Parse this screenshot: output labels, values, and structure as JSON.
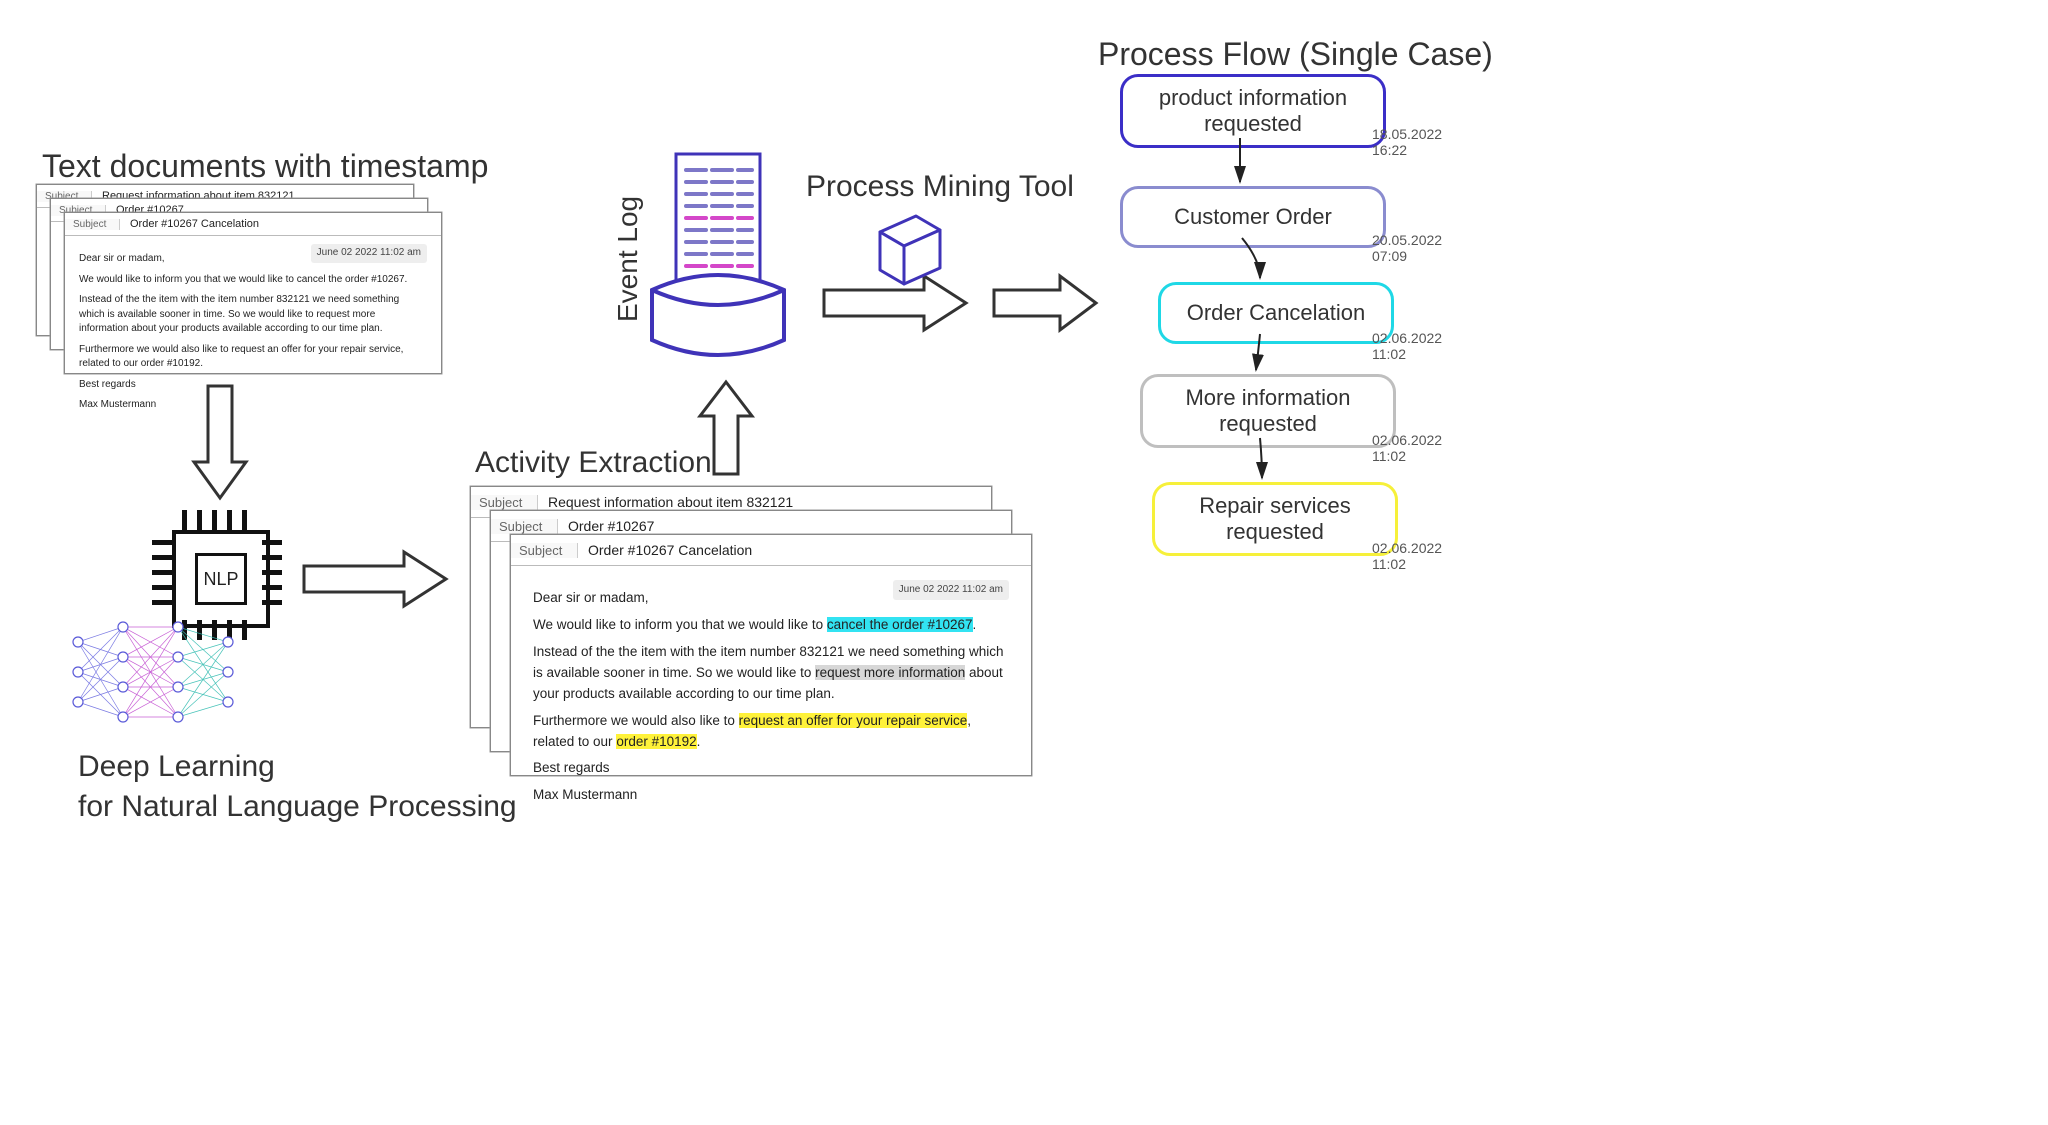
{
  "sectionTitles": {
    "documents": "Text documents with timestamp",
    "deepLearning1": "Deep Learning",
    "deepLearning2": "for Natural Language Processing",
    "activityExtraction": "Activity Extraction",
    "eventLog": "Event Log",
    "processMiningTool": "Process Mining Tool",
    "processFlow": "Process Flow (Single Case)"
  },
  "chipLabel": "NLP",
  "subjectFieldLabel": "Subject",
  "emails": {
    "s1_subject": "Request information about item 832121",
    "s2_subject": "Order #10267",
    "s3_subject": "Order #10267 Cancelation",
    "timestamp": "June 02 2022 11:02 am",
    "greeting": "Dear sir or madam,",
    "p1": "We would like to inform you that we would like to cancel the order #10267.",
    "p2": "Instead of the the item with the item number 832121 we need something which is available sooner in time. So we would like to request more information about your products available according to our time plan.",
    "p3": "Furthermore we would also like to request an offer for your repair service, related to our order #10192.",
    "closing1": "Best regards",
    "closing2": "Max Mustermann"
  },
  "extraction": {
    "p1_pre": "We would like to inform you that we would like to ",
    "p1_hl": "cancel the order #10267",
    "p1_post": ".",
    "p2_pre": "Instead of the the item with the item number 832121 we need something which is available sooner in time. So we would like to ",
    "p2_hl": "request more information",
    "p2_post": " about your products available according to our time plan.",
    "p3_pre": "Furthermore we would also like to ",
    "p3_hl1": "request an offer for your repair service",
    "p3_mid": ", related to our ",
    "p3_hl2": "order #10192",
    "p3_post": "."
  },
  "processFlowNodes": [
    {
      "label": "product information requested",
      "time": "18.05.2022 16:22",
      "color": "#3b2ec7"
    },
    {
      "label": "Customer Order",
      "time": "20.05.2022 07:09",
      "color": "#8a8ccf"
    },
    {
      "label": "Order Cancelation",
      "time": "02.06.2022 11:02",
      "color": "#1fd8e6"
    },
    {
      "label": "More information requested",
      "time": "02.06.2022 11:02",
      "color": "#bfbfbf"
    },
    {
      "label": "Repair services requested",
      "time": "02.06.2022 11:02",
      "color": "#f6f03a"
    }
  ],
  "colors": {
    "eventLogStroke": "#3f33b8",
    "arrowOutline": "#333"
  }
}
